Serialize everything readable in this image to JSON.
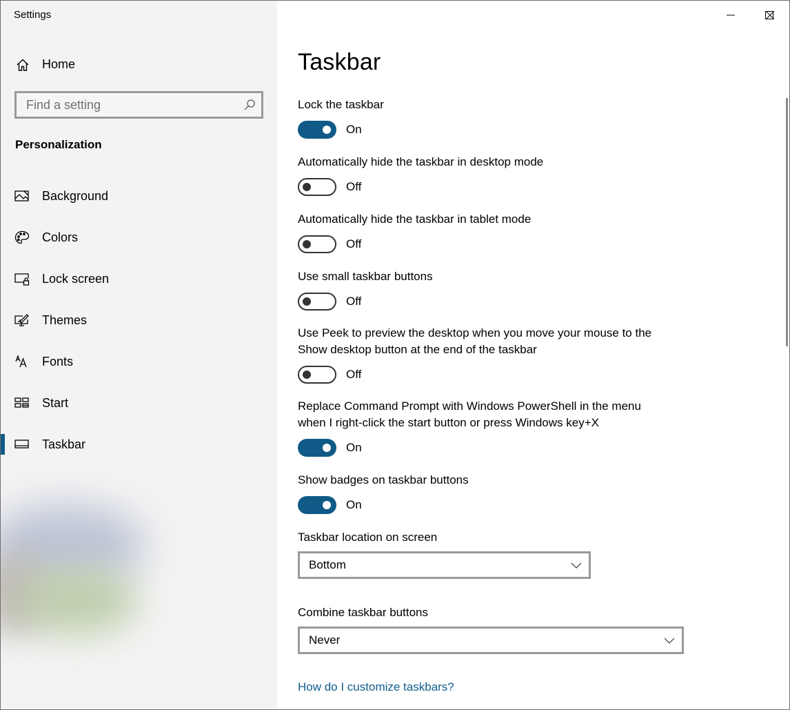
{
  "window": {
    "title": "Settings",
    "controls": {
      "minimize_icon": "minimize-icon",
      "maximize_icon": "maximize-icon",
      "close_icon": "close-icon"
    }
  },
  "sidebar": {
    "home": {
      "label": "Home",
      "icon": "home-icon"
    },
    "search": {
      "placeholder": "Find a setting",
      "value": "",
      "icon": "search-icon"
    },
    "section_title": "Personalization",
    "items": [
      {
        "label": "Background",
        "icon": "picture-icon",
        "selected": false
      },
      {
        "label": "Colors",
        "icon": "palette-icon",
        "selected": false
      },
      {
        "label": "Lock screen",
        "icon": "lock-screen-icon",
        "selected": false
      },
      {
        "label": "Themes",
        "icon": "themes-icon",
        "selected": false
      },
      {
        "label": "Fonts",
        "icon": "fonts-icon",
        "selected": false
      },
      {
        "label": "Start",
        "icon": "start-icon",
        "selected": false
      },
      {
        "label": "Taskbar",
        "icon": "taskbar-icon",
        "selected": true
      }
    ]
  },
  "main": {
    "title": "Taskbar",
    "accent_color": "#0f5a86",
    "toggles": [
      {
        "label": "Lock the taskbar",
        "state": "On",
        "on": true
      },
      {
        "label": "Automatically hide the taskbar in desktop mode",
        "state": "Off",
        "on": false
      },
      {
        "label": "Automatically hide the taskbar in tablet mode",
        "state": "Off",
        "on": false
      },
      {
        "label": "Use small taskbar buttons",
        "state": "Off",
        "on": false
      },
      {
        "label_line1": "Use Peek to preview the desktop when you move your mouse to the",
        "label_line2": "Show desktop button at the end of the taskbar",
        "state": "Off",
        "on": false
      },
      {
        "label_line1": "Replace Command Prompt with Windows PowerShell in the menu",
        "label_line2": "when I right-click the start button or press Windows key+X",
        "state": "On",
        "on": true
      },
      {
        "label": "Show badges on taskbar buttons",
        "state": "On",
        "on": true
      }
    ],
    "dropdowns": [
      {
        "label": "Taskbar location on screen",
        "value": "Bottom"
      },
      {
        "label": "Combine taskbar buttons",
        "value": "Never"
      }
    ],
    "help_link": "How do I customize taskbars?"
  }
}
